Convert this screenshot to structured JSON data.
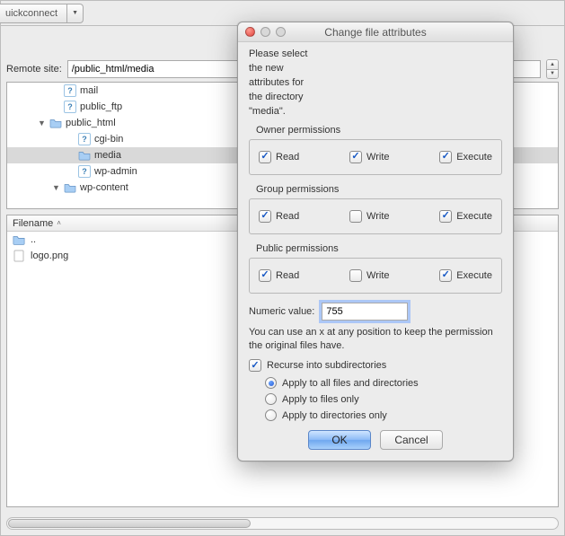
{
  "host": {
    "quickconnect_label": "uickconnect",
    "remote_label": "Remote site:",
    "remote_path": "/public_html/media",
    "tree": [
      {
        "indent": 46,
        "disc": "",
        "icon": "qmark",
        "label": "mail"
      },
      {
        "indent": 46,
        "disc": "",
        "icon": "qmark",
        "label": "public_ftp"
      },
      {
        "indent": 30,
        "disc": "▼",
        "icon": "folder",
        "label": "public_html"
      },
      {
        "indent": 62,
        "disc": "",
        "icon": "qmark",
        "label": "cgi-bin"
      },
      {
        "indent": 62,
        "disc": "",
        "icon": "folder",
        "label": "media",
        "selected": true
      },
      {
        "indent": 62,
        "disc": "",
        "icon": "qmark",
        "label": "wp-admin"
      },
      {
        "indent": 46,
        "disc": "▼",
        "icon": "folder",
        "label": "wp-content"
      }
    ],
    "filelist": {
      "header": "Filename",
      "rows": [
        {
          "icon": "folder",
          "name": ".."
        },
        {
          "icon": "file",
          "name": "logo.png"
        }
      ]
    }
  },
  "dialog": {
    "title": "Change file attributes",
    "intro": "Please select the new attributes for the directory \"media\".",
    "groups": [
      {
        "title": "Owner permissions",
        "perms": [
          {
            "label": "Read",
            "checked": true
          },
          {
            "label": "Write",
            "checked": true
          },
          {
            "label": "Execute",
            "checked": true
          }
        ]
      },
      {
        "title": "Group permissions",
        "perms": [
          {
            "label": "Read",
            "checked": true
          },
          {
            "label": "Write",
            "checked": false
          },
          {
            "label": "Execute",
            "checked": true
          }
        ]
      },
      {
        "title": "Public permissions",
        "perms": [
          {
            "label": "Read",
            "checked": true
          },
          {
            "label": "Write",
            "checked": false
          },
          {
            "label": "Execute",
            "checked": true
          }
        ]
      }
    ],
    "numeric_label": "Numeric value:",
    "numeric_value": "755",
    "note": "You can use an x at any position to keep the permission the original files have.",
    "recurse_label": "Recurse into subdirectories",
    "recurse_checked": true,
    "radios": [
      {
        "label": "Apply to all files and directories",
        "on": true
      },
      {
        "label": "Apply to files only",
        "on": false
      },
      {
        "label": "Apply to directories only",
        "on": false
      }
    ],
    "ok_label": "OK",
    "cancel_label": "Cancel"
  }
}
